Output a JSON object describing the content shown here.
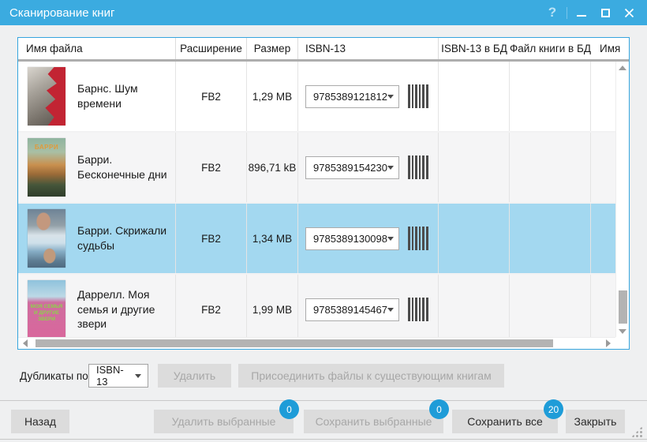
{
  "window": {
    "title": "Сканирование книг",
    "help_icon": "?"
  },
  "colors": {
    "titlebar": "#3babe0",
    "selection": "#a3d8f0",
    "badge": "#1e9cd8",
    "table_border": "#36a5de"
  },
  "table": {
    "columns": [
      "Имя файла",
      "Расширение",
      "Размер",
      "ISBN-13",
      "ISBN-13 в БД",
      "Файл книги в БД",
      "Имя"
    ],
    "rows": [
      {
        "file_name": "Барнс. Шум времени",
        "extension": "FB2",
        "size": "1,29 MB",
        "isbn13": "9785389121812",
        "isbn13_db": "",
        "file_db": "",
        "name_db": "",
        "selected": false,
        "cover_text": ""
      },
      {
        "file_name": "Барри. Бесконечные дни",
        "extension": "FB2",
        "size": "896,71 kB",
        "isbn13": "9785389154230",
        "isbn13_db": "",
        "file_db": "",
        "name_db": "",
        "selected": false,
        "cover_text": "БАРРИ"
      },
      {
        "file_name": "Барри. Скрижали судьбы",
        "extension": "FB2",
        "size": "1,34 MB",
        "isbn13": "9785389130098",
        "isbn13_db": "",
        "file_db": "",
        "name_db": "",
        "selected": true,
        "cover_text": ""
      },
      {
        "file_name": "Даррелл. Моя семья и другие звери",
        "extension": "FB2",
        "size": "1,99 MB",
        "isbn13": "9785389145467",
        "isbn13_db": "",
        "file_db": "",
        "name_db": "",
        "selected": false,
        "cover_text": "МОЯ СЕМЬЯ И ДРУГИЕ ЗВЕРИ"
      }
    ]
  },
  "toolbar": {
    "duplicates_label": "Дубликаты по:",
    "duplicates_value": "ISBN-13",
    "delete_label": "Удалить",
    "attach_label": "Присоединить файлы к существующим книгам"
  },
  "footer": {
    "back_label": "Назад",
    "delete_selected_label": "Удалить выбранные",
    "delete_selected_count": "0",
    "save_selected_label": "Сохранить выбранные",
    "save_selected_count": "0",
    "save_all_label": "Сохранить все",
    "save_all_count": "20",
    "close_label": "Закрыть"
  }
}
